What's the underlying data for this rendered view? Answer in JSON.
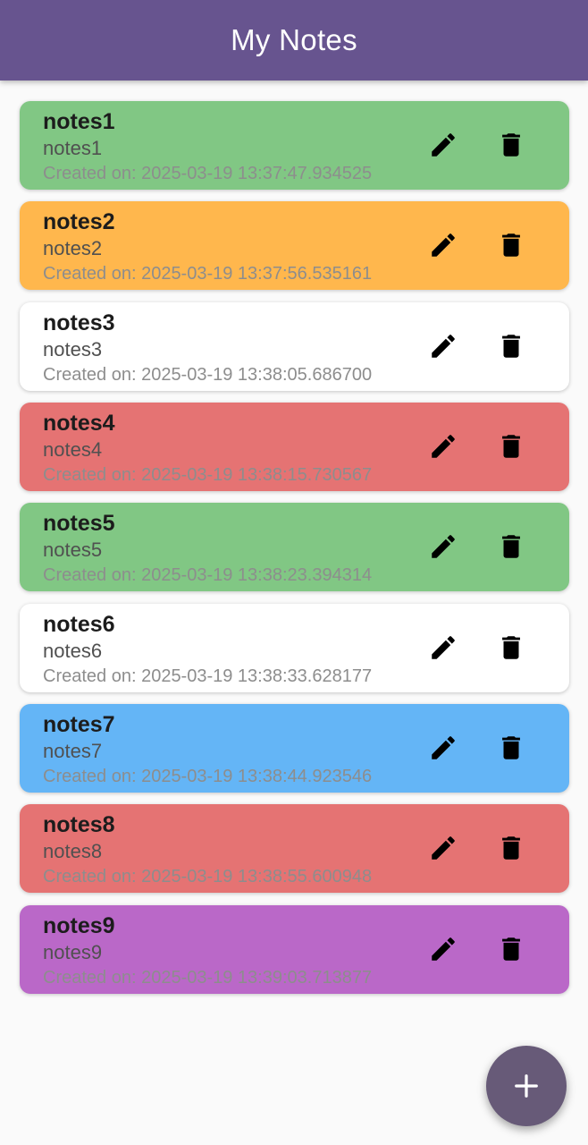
{
  "app_bar": {
    "title": "My Notes",
    "color": "#67548f"
  },
  "notes": [
    {
      "title": "notes1",
      "content": "notes1",
      "created": "Created on: 2025-03-19 13:37:47.934525",
      "color": "#81c784"
    },
    {
      "title": "notes2",
      "content": "notes2",
      "created": "Created on: 2025-03-19 13:37:56.535161",
      "color": "#ffb74d"
    },
    {
      "title": "notes3",
      "content": "notes3",
      "created": "Created on: 2025-03-19 13:38:05.686700",
      "color": "#ffffff"
    },
    {
      "title": "notes4",
      "content": "notes4",
      "created": "Created on: 2025-03-19 13:38:15.730567",
      "color": "#e57373"
    },
    {
      "title": "notes5",
      "content": "notes5",
      "created": "Created on: 2025-03-19 13:38:23.394314",
      "color": "#81c784"
    },
    {
      "title": "notes6",
      "content": "notes6",
      "created": "Created on: 2025-03-19 13:38:33.628177",
      "color": "#ffffff"
    },
    {
      "title": "notes7",
      "content": "notes7",
      "created": "Created on: 2025-03-19 13:38:44.923546",
      "color": "#64b5f6"
    },
    {
      "title": "notes8",
      "content": "notes8",
      "created": "Created on: 2025-03-19 13:38:55.600948",
      "color": "#e57373"
    },
    {
      "title": "notes9",
      "content": "notes9",
      "created": "Created on: 2025-03-19 13:39:03.713877",
      "color": "#ba68c8"
    }
  ],
  "icons": {
    "edit": "edit-icon",
    "delete": "delete-icon",
    "add": "add-icon"
  },
  "fab": {
    "color": "#675a78"
  }
}
